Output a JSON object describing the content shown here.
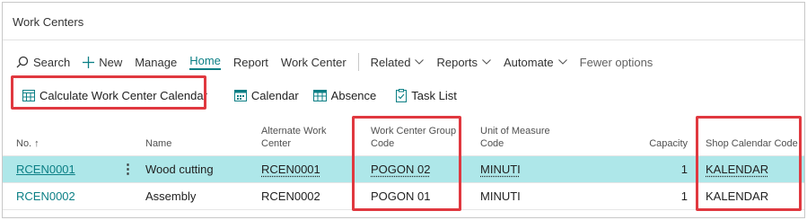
{
  "page": {
    "title": "Work Centers"
  },
  "actions": {
    "search": "Search",
    "new": "New",
    "manage": "Manage",
    "home": "Home",
    "report": "Report",
    "work_center": "Work Center",
    "related": "Related",
    "reports": "Reports",
    "automate": "Automate",
    "fewer_options": "Fewer options"
  },
  "home_actions": {
    "calc_calendar": "Calculate Work Center Calendar",
    "calendar": "Calendar",
    "absence": "Absence",
    "task_list": "Task List"
  },
  "columns": {
    "no": "No. ↑",
    "name": "Name",
    "alt_wc_1": "Alternate Work",
    "alt_wc_2": "Center",
    "wc_group_1": "Work Center Group",
    "wc_group_2": "Code",
    "uom_1": "Unit of Measure",
    "uom_2": "Code",
    "capacity": "Capacity",
    "shop_cal": "Shop Calendar Code"
  },
  "rows": [
    {
      "no": "RCEN0001",
      "name": "Wood cutting",
      "alt": "RCEN0001",
      "group": "POGON 02",
      "uom": "MINUTI",
      "capacity": "1",
      "shop_cal": "KALENDAR"
    },
    {
      "no": "RCEN0002",
      "name": "Assembly",
      "alt": "RCEN0002",
      "group": "POGON 01",
      "uom": "MINUTI",
      "capacity": "1",
      "shop_cal": "KALENDAR"
    }
  ],
  "colors": {
    "accent": "#0b7f85",
    "highlight": "#e0383f",
    "selected_row": "#aee7e9"
  },
  "icons": [
    "search-icon",
    "plus-icon",
    "chevron-down-icon",
    "calendar-grid-icon",
    "calendar-icon",
    "absence-icon",
    "task-list-icon",
    "more-options-icon"
  ]
}
